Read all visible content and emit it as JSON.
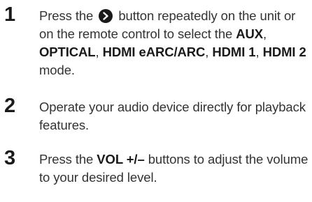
{
  "steps": [
    {
      "number": "1",
      "text_before_icon": "Press the",
      "icon": "source-button-icon",
      "text_after_icon": "button repeatedly on the unit or on the remote control to select the",
      "modes": [
        "AUX",
        "OPTICAL",
        "HDMI eARC/ARC",
        "HDMI 1",
        "HDMI 2"
      ],
      "separators": [
        ", ",
        ", ",
        ", ",
        ", "
      ],
      "text_end": "mode."
    },
    {
      "number": "2",
      "text": "Operate your audio device directly for playback features."
    },
    {
      "number": "3",
      "text_before": "Press the",
      "highlight": "VOL +/–",
      "text_after": "buttons to adjust the volume to your desired level."
    }
  ]
}
